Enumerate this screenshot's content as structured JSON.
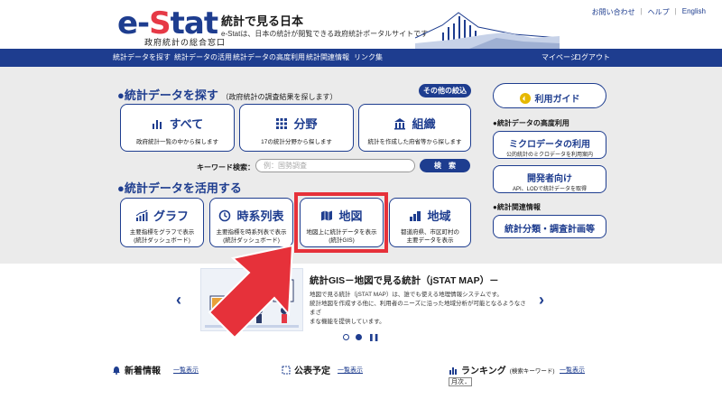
{
  "header": {
    "logo_main": "e-",
    "logo_s": "S",
    "logo_rest": "tat",
    "logo_sub": "政府統計の総合窓口",
    "site_title": "統計で見る日本",
    "site_desc": "e-Statは、日本の統計が閲覧できる政府統計ポータルサイトです",
    "top_links": [
      "お問い合わせ",
      "ヘルプ",
      "English"
    ]
  },
  "nav": {
    "items": [
      "統計データを探す",
      "統計データの活用",
      "統計データの高度利用",
      "統計関連情報",
      "リンク集"
    ],
    "mypage": "マイページ",
    "logout": "ログアウト"
  },
  "find": {
    "title": "●統計データを探す",
    "note": "（政府統計の調査結果を探します）",
    "other_btn": "その他の絞込",
    "cards": [
      {
        "title": "すべて",
        "sub": "政府統計一覧の中から探します",
        "icon": "bar-chart-icon"
      },
      {
        "title": "分野",
        "sub": "17の統計分野から探します",
        "icon": "grid-icon"
      },
      {
        "title": "組織",
        "sub": "統計を作成した府省等から探します",
        "icon": "building-icon"
      }
    ],
    "keyword_label": "キーワード検索：",
    "keyword_placeholder": "例：国勢調査",
    "search_btn": "検　索"
  },
  "use": {
    "title": "●統計データを活用する",
    "cards": [
      {
        "title": "グラフ",
        "sub1": "主要指標をグラフで表示",
        "sub2": "(統計ダッシュボード)",
        "icon": "graph-icon"
      },
      {
        "title": "時系列表",
        "sub1": "主要指標を時系列表で表示",
        "sub2": "(統計ダッシュボード)",
        "icon": "clock-icon"
      },
      {
        "title": "地図",
        "sub1": "地図上に統計データを表示",
        "sub2": "(統計GIS)",
        "icon": "map-icon"
      },
      {
        "title": "地域",
        "sub1": "都道府県、市区町村の",
        "sub2": "主要データを表示",
        "icon": "region-icon"
      }
    ]
  },
  "side": {
    "guide": "利用ガイド",
    "advanced_head": "●統計データの高度利用",
    "micro_title": "ミクロデータの利用",
    "micro_sub": "公的統計のミクロデータを利用案内",
    "dev_title": "開発者向け",
    "dev_sub": "API、LODで統計データを取得",
    "related_head": "●統計関連情報",
    "classification": "統計分類・調査計画等"
  },
  "banner": {
    "title": "統計GIS－地図で見る統計（jSTAT MAP）－",
    "text1": "地図で見る統計（jSTAT MAP）は、誰でも使える地理情報システムです。",
    "text2": "統計地図を作成する他に、利用者のニーズに沿った地域分析が可能となるようなさまざ",
    "text3": "まな機能を提供しています。",
    "prev": "‹",
    "next": "›",
    "pause": "❚❚"
  },
  "bottom": {
    "news": "新着情報",
    "news_link": "一覧表示",
    "schedule": "公表予定",
    "schedule_link": "一覧表示",
    "ranking": "ランキング",
    "ranking_note": "(検索キーワード)",
    "ranking_link": "一覧表示",
    "ranking_select": "月次"
  },
  "colors": {
    "brand": "#1e3d8f",
    "accent": "#e63946",
    "highlight": "#e6313a"
  }
}
